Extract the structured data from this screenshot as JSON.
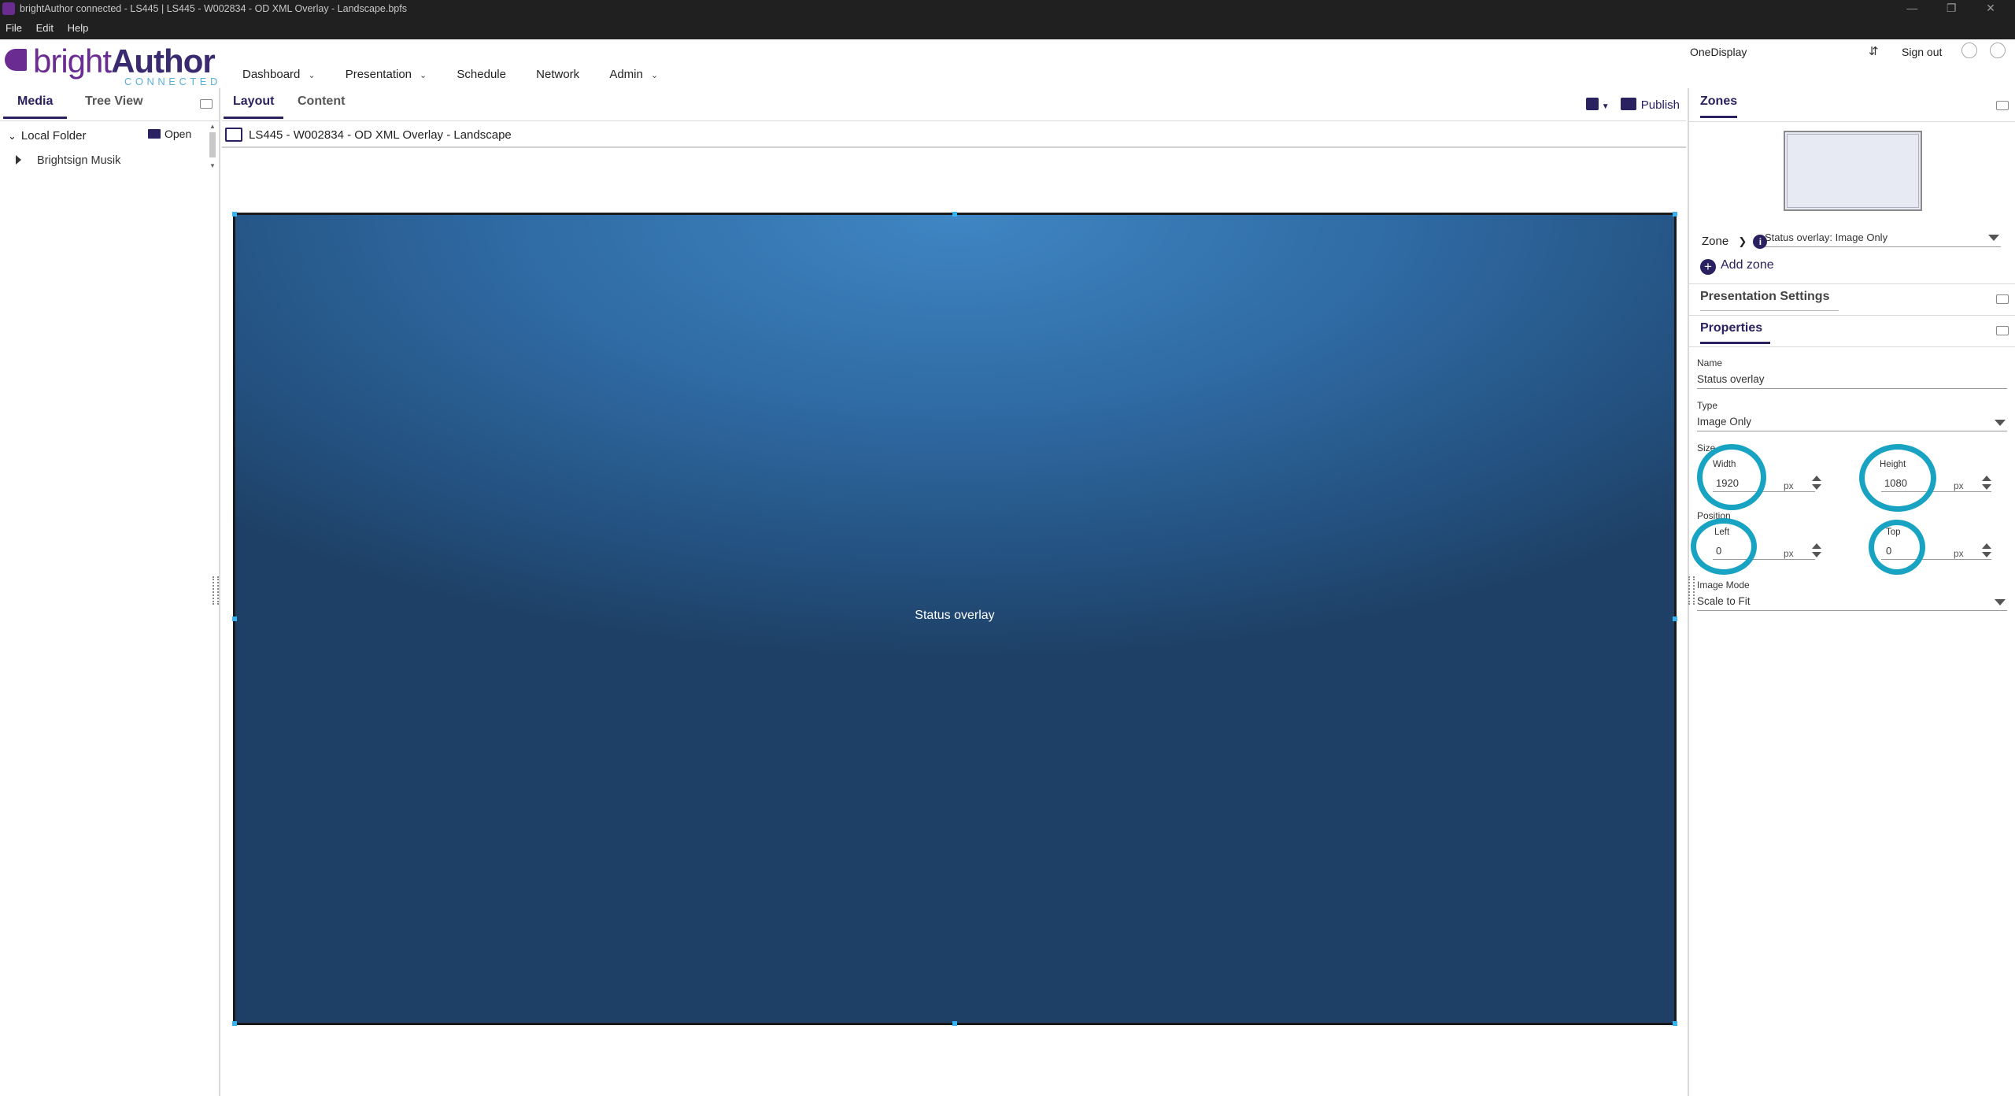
{
  "window": {
    "title": "brightAuthor connected - LS445 | LS445 - W002834 - OD XML Overlay - Landscape.bpfs",
    "menus": [
      "File",
      "Edit",
      "Help"
    ],
    "controls": [
      "—",
      "❐",
      "✕"
    ]
  },
  "header": {
    "logo_light": "bright",
    "logo_bold": "Author",
    "logo_sub": "CONNECTED",
    "nav": [
      "Dashboard",
      "Presentation",
      "Schedule",
      "Network",
      "Admin"
    ],
    "account": "OneDisplay",
    "sign_out": "Sign out"
  },
  "left": {
    "tabs": [
      "Media",
      "Tree View"
    ],
    "folder": "Local Folder",
    "open_label": "Open",
    "items": [
      "Brightsign Musik"
    ]
  },
  "center": {
    "tabs": [
      "Layout",
      "Content"
    ],
    "publish_label": "Publish",
    "path": "LS445 - W002834 - OD XML Overlay - Landscape",
    "zone_label": "Status overlay"
  },
  "right": {
    "zones_title": "Zones",
    "zone_label": "Zone",
    "zone_selected": "Status overlay: Image Only",
    "add_zone": "Add zone",
    "presentation_settings": "Presentation Settings",
    "properties_title": "Properties",
    "name_label": "Name",
    "name_value": "Status overlay",
    "type_label": "Type",
    "type_value": "Image Only",
    "size_label": "Size",
    "width_label": "Width",
    "width_value": "1920",
    "height_label": "Height",
    "height_value": "1080",
    "position_label": "Position",
    "left_label": "Left",
    "left_value": "0",
    "top_label": "Top",
    "top_value": "0",
    "unit": "px",
    "image_mode_label": "Image Mode",
    "image_mode_value": "Scale to Fit"
  },
  "colors": {
    "brand_purple": "#6a2c91",
    "brand_navy": "#2a2160",
    "highlight_ring": "#19a3c2",
    "handle": "#36b3f2"
  }
}
